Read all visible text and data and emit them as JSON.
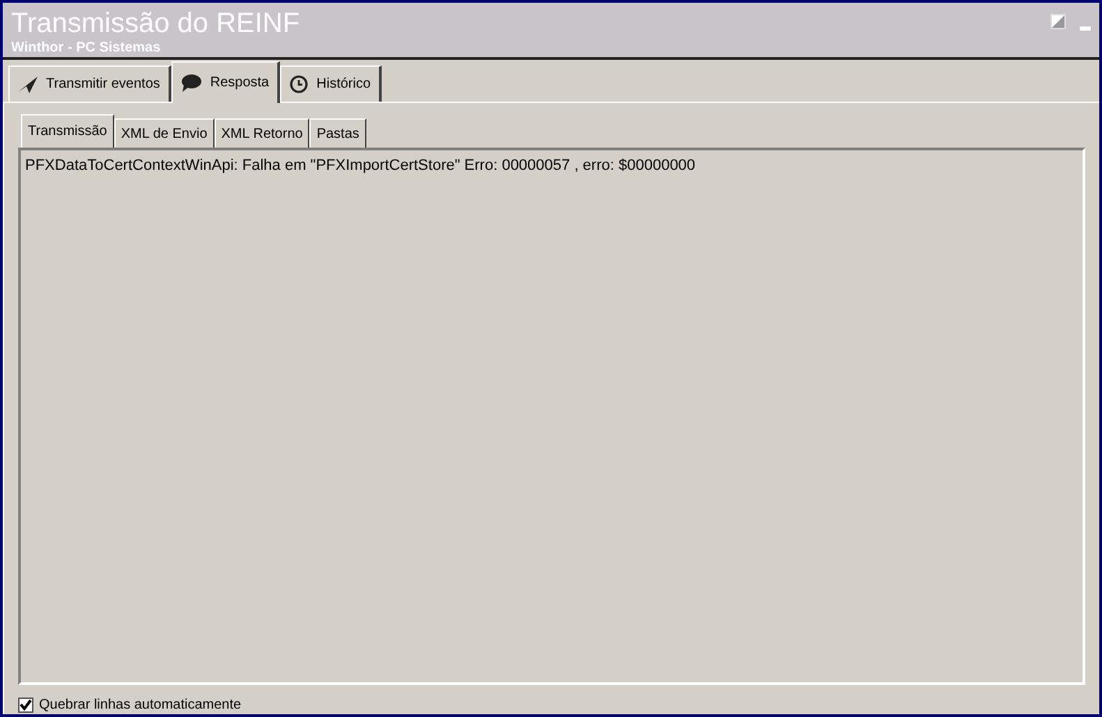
{
  "window": {
    "title": "Transmissão do REINF",
    "subtitle": "Winthor - PC Sistemas"
  },
  "tabs": [
    {
      "label": "Transmitir eventos",
      "kind": "send",
      "selected": false
    },
    {
      "label": "Resposta",
      "kind": "chat",
      "selected": true
    },
    {
      "label": "Histórico",
      "kind": "clock",
      "selected": false
    }
  ],
  "subtabs": [
    {
      "label": "Transmissão",
      "selected": true
    },
    {
      "label": "XML de Envio",
      "selected": false
    },
    {
      "label": "XML Retorno",
      "selected": false
    },
    {
      "label": "Pastas",
      "selected": false
    }
  ],
  "message": "PFXDataToCertContextWinApi: Falha em \"PFXImportCertStore\" Erro: 00000057 , erro: $00000000",
  "word_wrap": {
    "label": "Quebrar linhas automaticamente",
    "checked": true
  }
}
